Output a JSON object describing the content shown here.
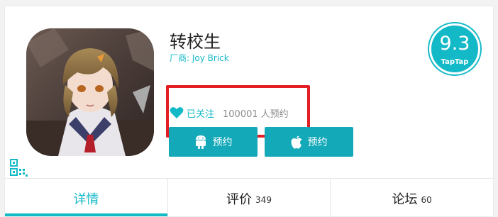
{
  "game": {
    "title": "转校生",
    "vendor_label": "厂商:",
    "vendor_name": "Joy Brick"
  },
  "rating": {
    "score": "9.3",
    "brand": "TapTap"
  },
  "follow": {
    "label": "已关注",
    "count": "100001",
    "suffix": "人预约"
  },
  "buttons": {
    "android_label": "预约",
    "ios_label": "预约"
  },
  "tabs": [
    {
      "label": "详情",
      "count": ""
    },
    {
      "label": "评价",
      "count": "349"
    },
    {
      "label": "论坛",
      "count": "60"
    }
  ],
  "colors": {
    "accent": "#14b9c8",
    "button": "#14a9b8",
    "highlight": "#e31e24"
  },
  "icons": [
    "game-cover-image",
    "qr-code-icon",
    "heart-icon",
    "android-icon",
    "apple-icon"
  ]
}
